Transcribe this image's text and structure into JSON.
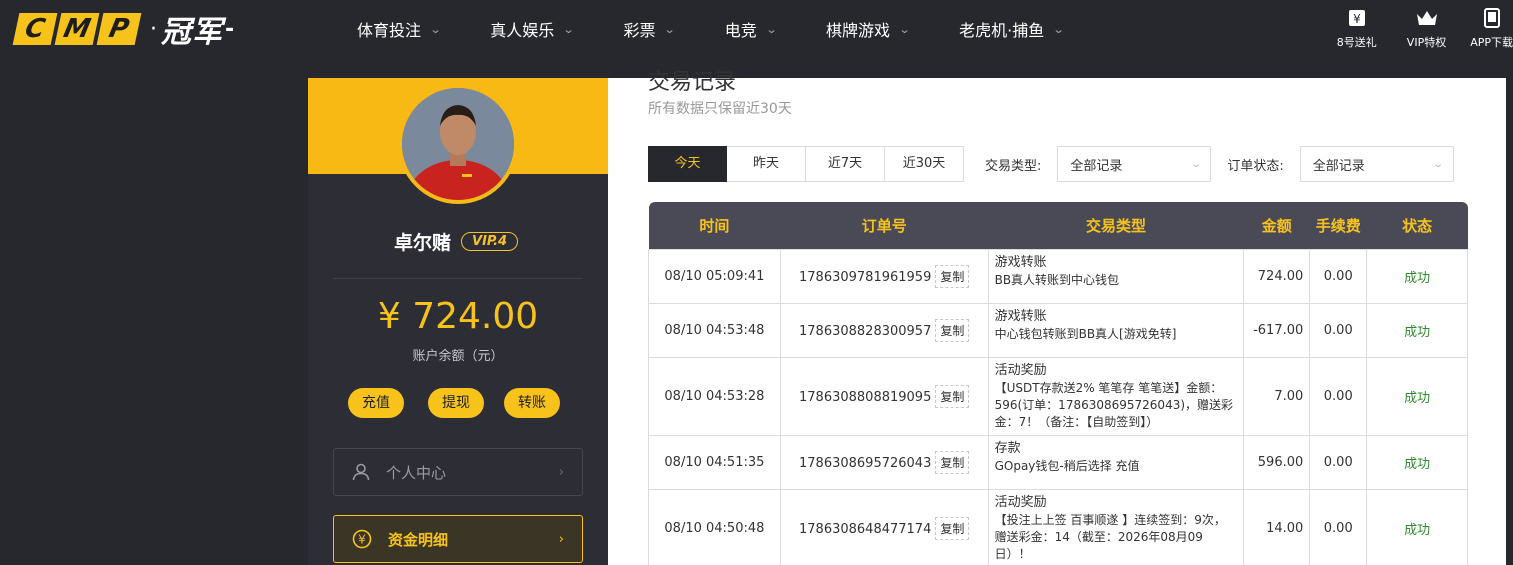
{
  "brand": {
    "cmp_letters": [
      "C",
      "M",
      "P"
    ],
    "dot": "·",
    "name_cn": "冠军",
    "dash": "-"
  },
  "nav": {
    "items": [
      {
        "label": "体育投注"
      },
      {
        "label": "真人娱乐"
      },
      {
        "label": "彩票"
      },
      {
        "label": "电竞"
      },
      {
        "label": "棋牌游戏"
      },
      {
        "label": "老虎机·捕鱼"
      }
    ],
    "right": [
      {
        "label": "8号送礼",
        "icon": "gift-icon"
      },
      {
        "label": "VIP特权",
        "icon": "crown-icon"
      },
      {
        "label": "APP下载",
        "icon": "phone-icon"
      }
    ]
  },
  "profile": {
    "username": "卓尔赌",
    "vip": "VIP.4",
    "balance": "¥ 724.00",
    "balance_label": "账户余额（元）",
    "actions": [
      "充值",
      "提现",
      "转账"
    ],
    "menu": [
      {
        "label": "个人中心",
        "icon": "user-icon",
        "active": false
      },
      {
        "label": "资金明细",
        "icon": "yuan-coin-icon",
        "active": true
      }
    ]
  },
  "main": {
    "title": "交易记录",
    "subtitle": "所有数据只保留近30天",
    "tabs": [
      "今天",
      "昨天",
      "近7天",
      "近30天"
    ],
    "active_tab": 0,
    "filters": {
      "type_label": "交易类型:",
      "type_value": "全部记录",
      "status_label": "订单状态:",
      "status_value": "全部记录"
    },
    "table": {
      "headers": [
        "时间",
        "订单号",
        "交易类型",
        "金额",
        "手续费",
        "状态"
      ],
      "copy_label": "复制",
      "rows": [
        {
          "time": "08/10 05:09:41",
          "order": "1786309781961959",
          "type": "游戏转账",
          "desc": "BB真人转账到中心钱包",
          "amount": "724.00",
          "fee": "0.00",
          "status": "成功"
        },
        {
          "time": "08/10 04:53:48",
          "order": "1786308828300957",
          "type": "游戏转账",
          "desc": "中心钱包转账到BB真人[游戏免转]",
          "amount": "-617.00",
          "fee": "0.00",
          "status": "成功"
        },
        {
          "time": "08/10 04:53:28",
          "order": "1786308808819095",
          "type": "活动奖励",
          "desc": "【USDT存款送2% 笔笔存 笔笔送】金额：596(订单：1786308695726043)，赠送彩金：7！（备注：【自助签到】）",
          "amount": "7.00",
          "fee": "0.00",
          "status": "成功"
        },
        {
          "time": "08/10 04:51:35",
          "order": "1786308695726043",
          "type": "存款",
          "desc": "GOpay钱包-稍后选择 充值",
          "amount": "596.00",
          "fee": "0.00",
          "status": "成功"
        },
        {
          "time": "08/10 04:50:48",
          "order": "1786308648477174",
          "type": "活动奖励",
          "desc": "【投注上上签 百事顺遂 】连续签到：9次，赠送彩金：14（截至：2026年08月09日）！",
          "amount": "14.00",
          "fee": "0.00",
          "status": "成功"
        }
      ]
    }
  },
  "colors": {
    "accent": "#f7c31a",
    "dark": "#27282e",
    "success": "#2e8b2e"
  }
}
